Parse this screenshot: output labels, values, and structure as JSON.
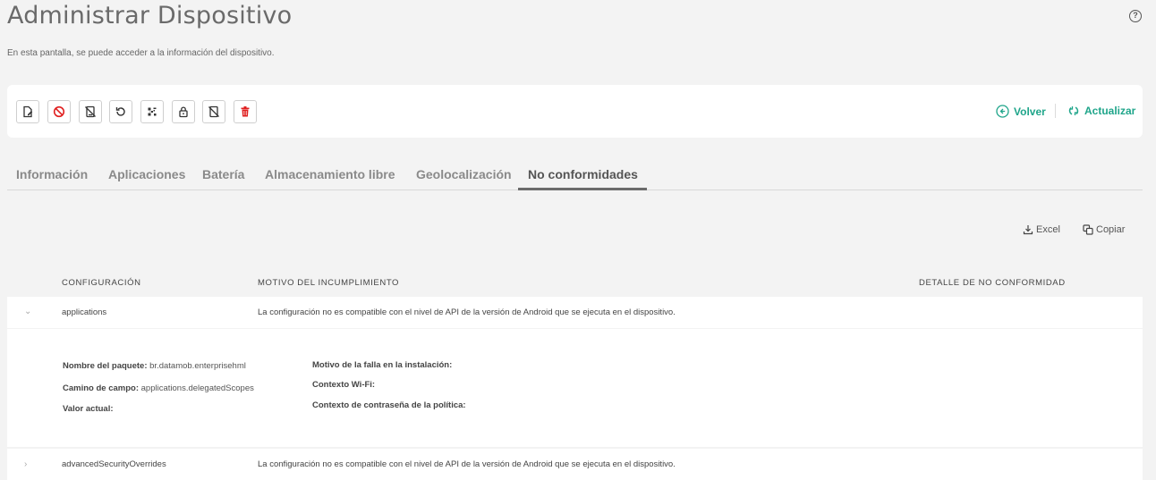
{
  "header": {
    "title": "Administrar Dispositivo",
    "subtitle": "En esta pantalla, se puede acceder a la información del dispositivo.",
    "help_icon": "help-circle-icon"
  },
  "toolbar": {
    "buttons": [
      {
        "name": "edit-icon",
        "color": "#333333"
      },
      {
        "name": "block-icon",
        "color": "#e02020"
      },
      {
        "name": "device-off-icon",
        "color": "#333333"
      },
      {
        "name": "reset-icon",
        "color": "#333333"
      },
      {
        "name": "qr-code-icon",
        "color": "#333333"
      },
      {
        "name": "lock-icon",
        "color": "#333333"
      },
      {
        "name": "device-wipe-icon",
        "color": "#333333"
      },
      {
        "name": "trash-icon",
        "color": "#e02020"
      }
    ],
    "back_label": "Volver",
    "refresh_label": "Actualizar",
    "accent": "#1fa58a"
  },
  "tabs": [
    {
      "label": "Información",
      "active": false
    },
    {
      "label": "Aplicaciones",
      "active": false
    },
    {
      "label": "Batería",
      "active": false
    },
    {
      "label": "Almacenamiento libre",
      "active": false
    },
    {
      "label": "Geolocalización",
      "active": false
    },
    {
      "label": "No conformidades",
      "active": true
    }
  ],
  "export": {
    "excel_label": "Excel",
    "copy_label": "Copiar"
  },
  "table": {
    "columns": [
      "CONFIGURACIÓN",
      "MOTIVO DEL INCUMPLIMIENTO",
      "DETALLE DE NO CONFORMIDAD"
    ],
    "rows": [
      {
        "configuracion": "applications",
        "motivo": "La configuración no es compatible con el nivel de API de la versión de Android que se ejecuta en el dispositivo.",
        "expanded": true
      },
      {
        "configuracion": "advancedSecurityOverrides",
        "motivo": "La configuración no es compatible con el nivel de API de la versión de Android que se ejecuta en el dispositivo.",
        "expanded": false
      }
    ],
    "details": {
      "package_label": "Nombre del paquete:",
      "package_value": "br.datamob.enterprisehml",
      "field_path_label": "Camino de campo:",
      "field_path_value": "applications.delegatedScopes",
      "current_value_label": "Valor actual:",
      "install_failure_label": "Motivo de la falla en la instalación:",
      "wifi_context_label": "Contexto Wi-Fi:",
      "password_context_label": "Contexto de contraseña de la política:"
    }
  }
}
